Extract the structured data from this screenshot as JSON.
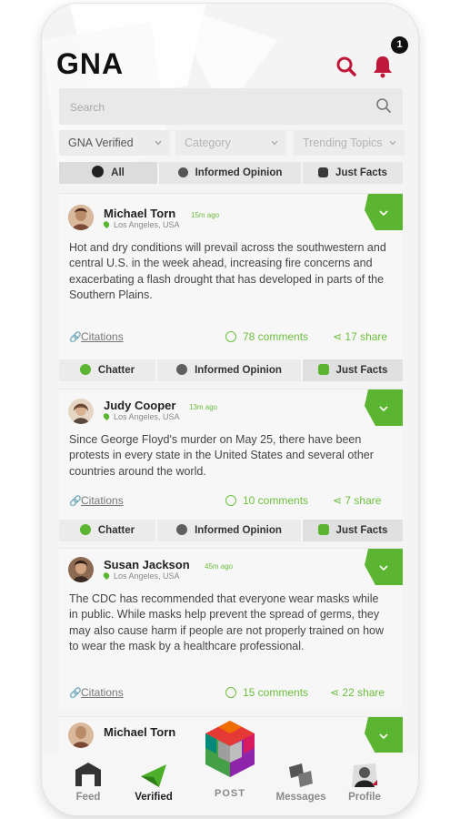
{
  "app": {
    "logo": "GNA",
    "notification_count": "1"
  },
  "search": {
    "placeholder": "Search"
  },
  "filters": {
    "source": "GNA Verified",
    "category": "Category",
    "trending": "Trending Topics"
  },
  "tabs": [
    "All",
    "Informed Opinion",
    "Just Facts"
  ],
  "posts": [
    {
      "author": "Michael Torn",
      "time": "15m ago",
      "location": "Los Angeles, USA",
      "body": "Hot and dry conditions will prevail across the southwestern and central U.S. in the week ahead, increasing fire concerns and exacerbating a flash drought that has developed in parts of the Southern Plains.",
      "citations": "Citations",
      "comments": "78 comments",
      "share": "17 share"
    },
    {
      "author": "Judy Cooper",
      "time": "13m ago",
      "location": "Los Angeles, USA",
      "body": "Since George Floyd's murder on May 25, there have been protests in every state in the United States and several other countries around the world.",
      "citations": "Citations",
      "comments": "10 comments",
      "share": "7 share"
    },
    {
      "author": "Susan Jackson",
      "time": "45m ago",
      "location": "Los Angeles, USA",
      "body": "The CDC has recommended that everyone wear masks while in public. While masks help prevent the spread of germs, they may also cause harm if people are not properly trained on how to wear the mask by a healthcare professional.",
      "citations": "Citations",
      "comments": "15 comments",
      "share": "22 share"
    },
    {
      "author": "Michael Torn"
    }
  ],
  "reactions": [
    "Chatter",
    "Informed Opinion",
    "Just Facts"
  ],
  "nav": {
    "feed": "Feed",
    "verified": "Verified",
    "post": "POST",
    "messages": "Messages",
    "profile": "Profile"
  },
  "colors": {
    "accent_green": "#5cb531",
    "brand_red": "#c0183a",
    "text_dark": "#222222"
  }
}
